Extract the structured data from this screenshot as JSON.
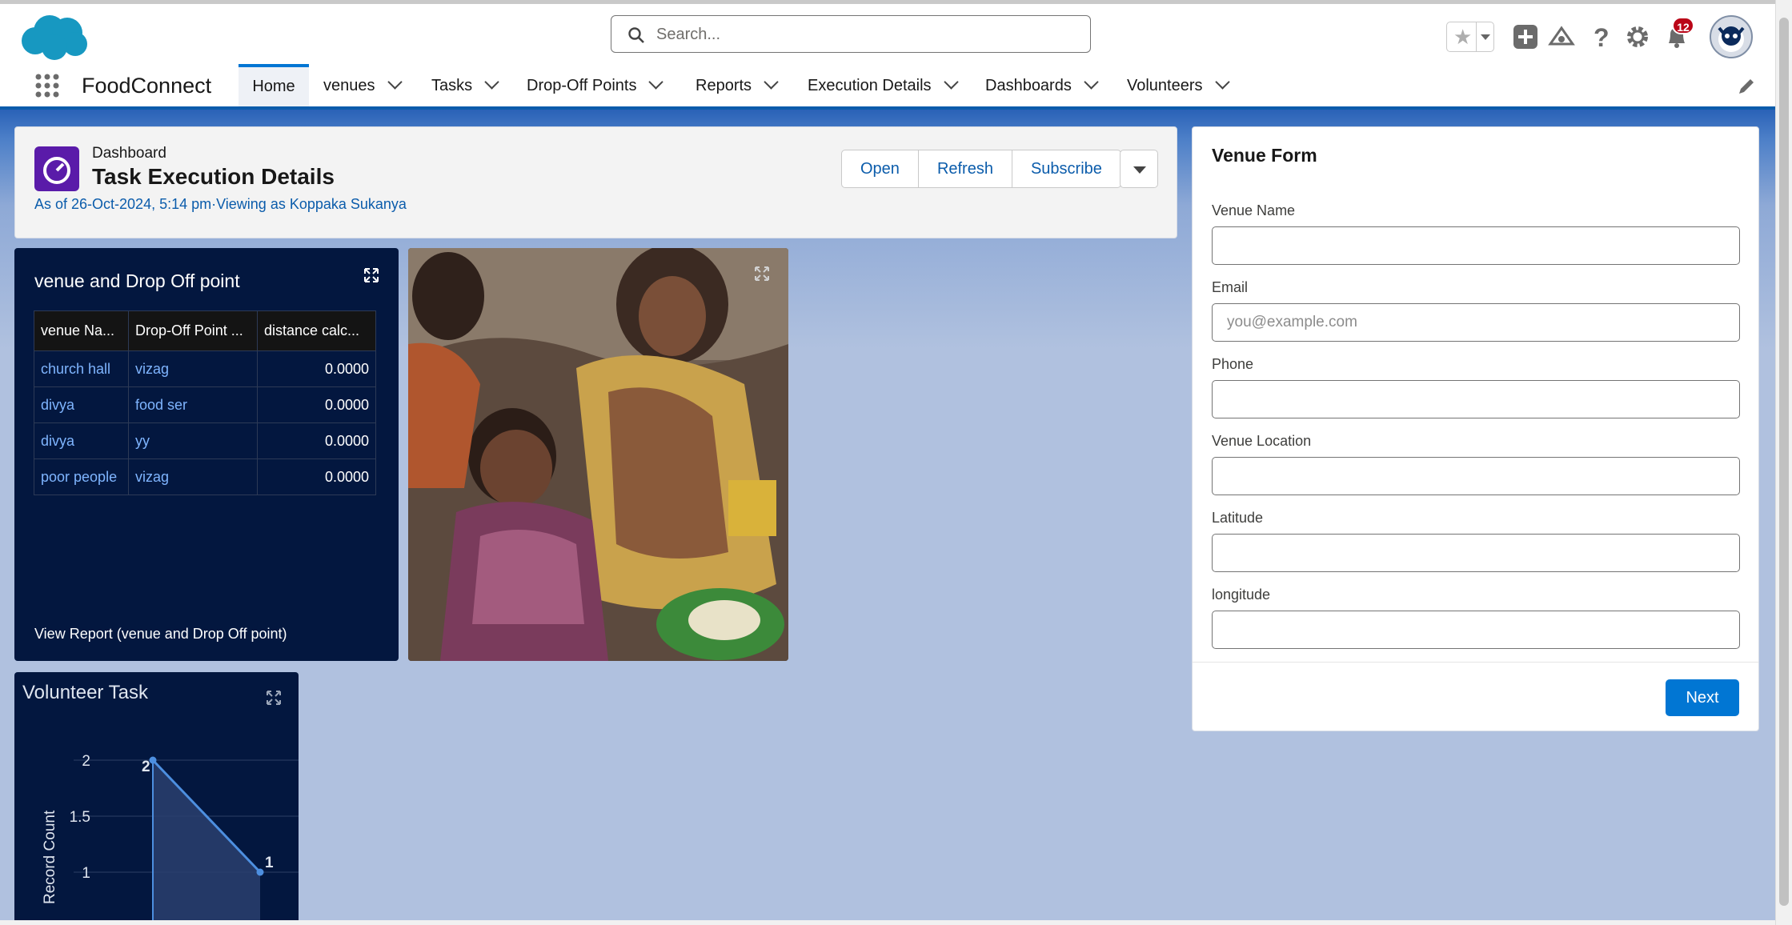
{
  "header": {
    "search_placeholder": "Search...",
    "notification_count": "12"
  },
  "nav": {
    "app_name": "FoodConnect",
    "tabs": [
      {
        "label": "Home",
        "active": true
      },
      {
        "label": "venues"
      },
      {
        "label": "Tasks"
      },
      {
        "label": "Drop-Off Points"
      },
      {
        "label": "Reports"
      },
      {
        "label": "Execution Details"
      },
      {
        "label": "Dashboards"
      },
      {
        "label": "Volunteers"
      }
    ]
  },
  "dashboard": {
    "type_label": "Dashboard",
    "title": "Task Execution Details",
    "as_of": "As of 26-Oct-2024, 5:14 pm·Viewing as Koppaka Sukanya",
    "buttons": {
      "open": "Open",
      "refresh": "Refresh",
      "subscribe": "Subscribe"
    }
  },
  "venue_table": {
    "title": "venue and Drop Off point",
    "columns": [
      "venue Na...",
      "Drop-Off Point ...",
      "distance calc..."
    ],
    "rows": [
      [
        "church hall",
        "vizag",
        "0.0000"
      ],
      [
        "divya",
        "food ser",
        "0.0000"
      ],
      [
        "divya",
        "yy",
        "0.0000"
      ],
      [
        "poor people",
        "vizag",
        "0.0000"
      ]
    ],
    "view_report": "View Report (venue and Drop Off point)"
  },
  "venue_form": {
    "title": "Venue Form",
    "fields": [
      {
        "label": "Venue Name",
        "value": "",
        "placeholder": ""
      },
      {
        "label": "Email",
        "value": "",
        "placeholder": "you@example.com"
      },
      {
        "label": "Phone",
        "value": "",
        "placeholder": ""
      },
      {
        "label": "Venue Location",
        "value": "",
        "placeholder": ""
      },
      {
        "label": "Latitude",
        "value": "",
        "placeholder": ""
      },
      {
        "label": "longitude",
        "value": "",
        "placeholder": ""
      }
    ],
    "next_label": "Next"
  },
  "volunteer_chart": {
    "title": "Volunteer Task"
  },
  "chart_data": {
    "type": "line",
    "title": "Volunteer Task",
    "xlabel": "",
    "ylabel": "Record Count",
    "y_ticks": [
      "2",
      "1.5",
      "1"
    ],
    "series": [
      {
        "values": [
          2,
          1
        ]
      }
    ],
    "data_labels": [
      "2",
      "1"
    ],
    "ylim": [
      0.5,
      2.2
    ],
    "grid": true,
    "colors": {
      "line": "#4d8fe0",
      "area": "#2a3f6e"
    }
  },
  "colors": {
    "brand_blue": "#0176d3",
    "nav_underline": "#0b5cab",
    "widget_bg": "#03173f",
    "badge": "#ba0517",
    "dashboard_icon": "#5a1ba9"
  }
}
